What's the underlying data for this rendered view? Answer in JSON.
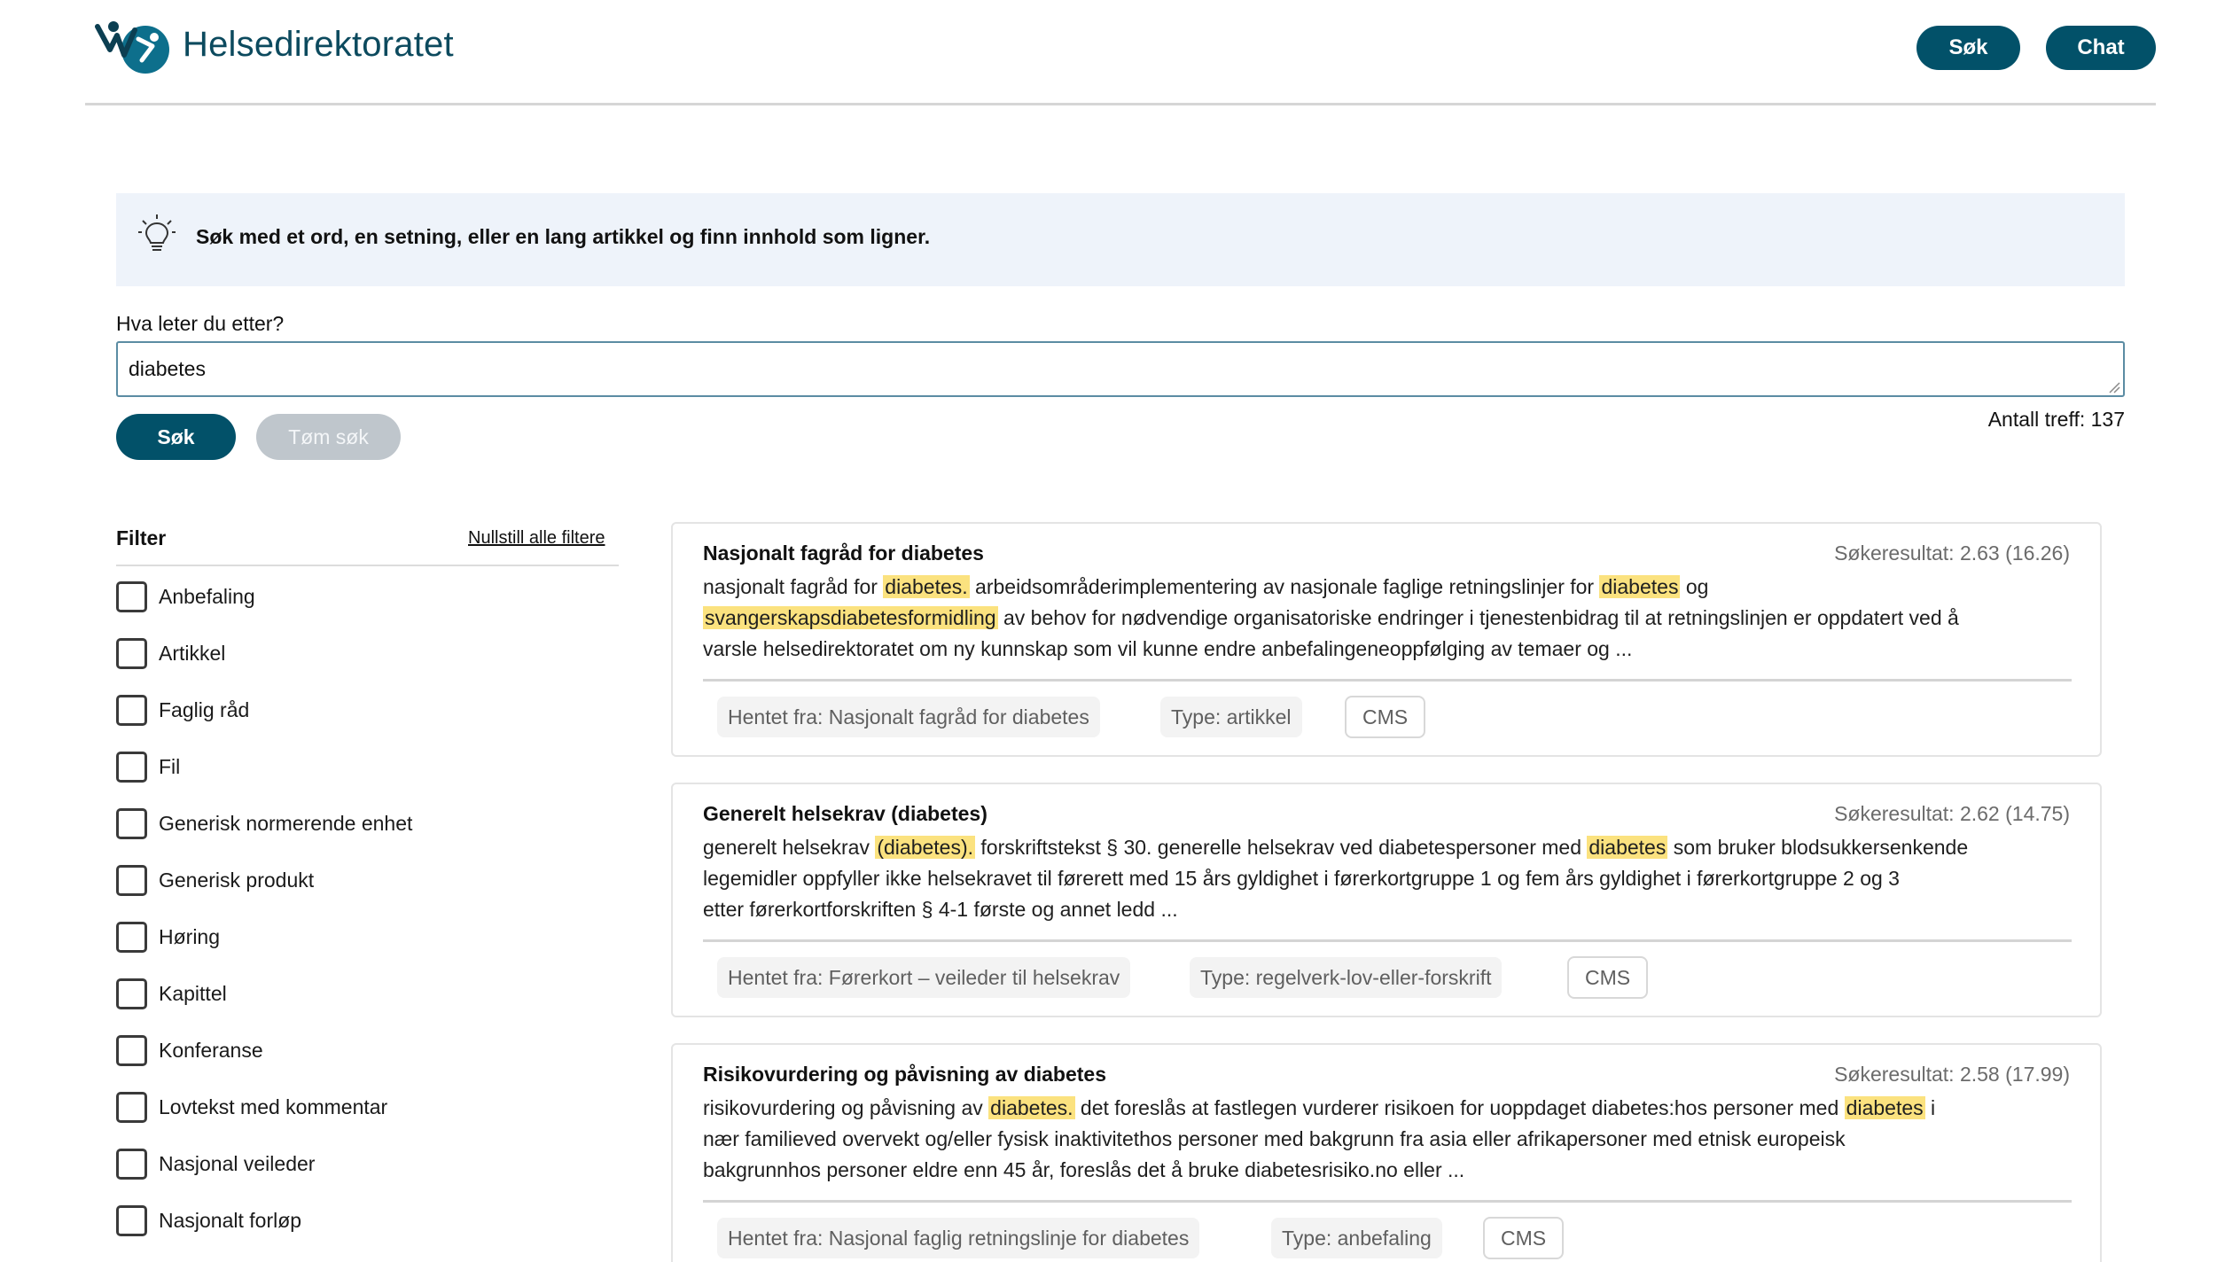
{
  "header": {
    "brand": "Helsedirektoratet",
    "search_button": "Søk",
    "chat_button": "Chat"
  },
  "banner": {
    "icon": "lightbulb-icon",
    "text": "Søk med et ord, en setning, eller en lang artikkel og finn innhold som ligner."
  },
  "search": {
    "label": "Hva leter du etter?",
    "value": "diabetes",
    "search_button": "Søk",
    "clear_button": "Tøm søk",
    "hit_count": "Antall treff: 137"
  },
  "filter": {
    "title": "Filter",
    "reset": "Nullstill alle filtere",
    "items": [
      "Anbefaling",
      "Artikkel",
      "Faglig råd",
      "Fil",
      "Generisk normerende enhet",
      "Generisk produkt",
      "Høring",
      "Kapittel",
      "Konferanse",
      "Lovtekst med kommentar",
      "Nasjonal veileder",
      "Nasjonalt forløp"
    ]
  },
  "results": [
    {
      "title": "Nasjonalt fagråd for diabetes",
      "score": "Søkeresultat: 2.63 (16.26)",
      "line1": [
        "nasjonalt fagråd for ",
        "diabetes.",
        " arbeidsområderimplementering av nasjonale faglige retningslinjer for ",
        "diabetes",
        " og"
      ],
      "line2": [
        "svangerskapsdiabetesformidling",
        " av behov for nødvendige organisatoriske endringer i tjenestenbidrag til at retningslinjen er oppdatert ved å"
      ],
      "line3": "varsle helsedirektoratet om ny kunnskap som vil kunne endre anbefalingeneoppfølging av temaer og ...",
      "source": "Hentet fra: Nasjonalt fagråd for diabetes",
      "type": "Type: artikkel",
      "cms": "CMS"
    },
    {
      "title": "Generelt helsekrav (diabetes)",
      "score": "Søkeresultat: 2.62 (14.75)",
      "line1": [
        "generelt helsekrav ",
        "(diabetes).",
        " forskriftstekst § 30. generelle helsekrav ved diabetespersoner med ",
        "diabetes",
        " som bruker blodsukkersenkende"
      ],
      "line2": "legemidler oppfyller ikke helsekravet til førerett med 15 års gyldighet i førerkortgruppe 1 og fem års gyldighet i førerkortgruppe 2 og 3",
      "line3": "etter førerkortforskriften § 4-1 første og annet ledd ...",
      "source": "Hentet fra: Førerkort – veileder til helsekrav",
      "type": "Type: regelverk-lov-eller-forskrift",
      "cms": "CMS"
    },
    {
      "title": "Risikovurdering og påvisning av diabetes",
      "score": "Søkeresultat: 2.58 (17.99)",
      "line1": [
        "risikovurdering og påvisning av ",
        "diabetes.",
        " det foreslås at fastlegen vurderer risikoen for uoppdaget diabetes:hos personer med ",
        "diabetes",
        " i"
      ],
      "line2": "nær familieved overvekt og/eller fysisk inaktivitethos personer med bakgrunn fra asia eller afrikapersoner med etnisk europeisk",
      "line3": "bakgrunnhos personer eldre enn 45 år, foreslås det å bruke diabetesrisiko.no eller ...",
      "source": "Hentet fra: Nasjonal faglig retningslinje for diabetes",
      "type": "Type: anbefaling",
      "cms": "CMS"
    }
  ]
}
